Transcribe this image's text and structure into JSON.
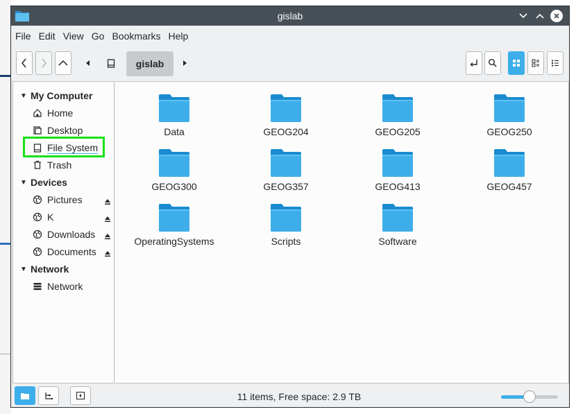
{
  "window": {
    "title": "gislab"
  },
  "menubar": {
    "items": [
      "File",
      "Edit",
      "View",
      "Go",
      "Bookmarks",
      "Help"
    ]
  },
  "toolbar": {
    "breadcrumb": "gislab"
  },
  "sidebar": {
    "groups": [
      {
        "label": "My Computer",
        "items": [
          "Home",
          "Desktop",
          "File System",
          "Trash"
        ]
      },
      {
        "label": "Devices",
        "items": [
          "Pictures",
          "K",
          "Downloads",
          "Documents"
        ]
      },
      {
        "label": "Network",
        "items": [
          "Network"
        ]
      }
    ]
  },
  "files": [
    "Data",
    "GEOG204",
    "GEOG205",
    "GEOG250",
    "GEOG300",
    "GEOG357",
    "GEOG413",
    "GEOG457",
    "OperatingSystems",
    "Scripts",
    "Software"
  ],
  "statusbar": {
    "text": "11 items, Free space: 2.9 TB",
    "zoom_level": 0.5
  },
  "colors": {
    "accent": "#3daee9",
    "highlight": "#18e018",
    "folder": "#3daee9",
    "titlebar": "#475057"
  }
}
